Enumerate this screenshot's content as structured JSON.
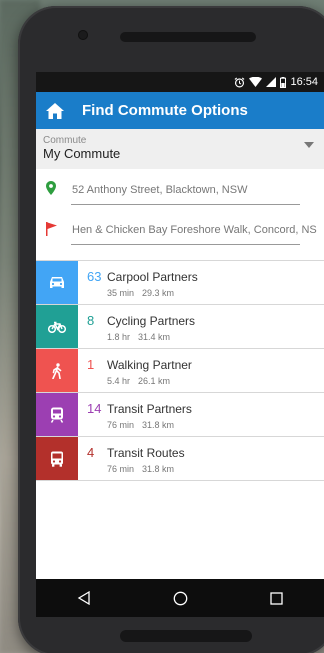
{
  "status_bar": {
    "time": "16:54",
    "icons": [
      "alarm-icon",
      "wifi-icon",
      "signal-icon",
      "battery-icon"
    ]
  },
  "app_bar": {
    "title": "Find Commute Options",
    "icon": "home-icon"
  },
  "commute": {
    "label": "Commute",
    "value": "My Commute"
  },
  "origin": {
    "text": "52 Anthony Street, Blacktown, NSW",
    "icon": "map-pin-icon",
    "color": "#2e9e3f"
  },
  "destination": {
    "text": "Hen & Chicken Bay Foreshore Walk, Concord, NS",
    "icon": "flag-icon",
    "color": "#e53935"
  },
  "options": [
    {
      "count": "63",
      "name": "Carpool Partners",
      "time": "35 min",
      "distance": "29.3 km",
      "icon": "car-icon",
      "tile_color": "#42a5f5",
      "count_color": "#42a5f5"
    },
    {
      "count": "8",
      "name": "Cycling Partners",
      "time": "1.8 hr",
      "distance": "31.4 km",
      "icon": "bicycle-icon",
      "tile_color": "#20a095",
      "count_color": "#20a095"
    },
    {
      "count": "1",
      "name": "Walking Partner",
      "time": "5.4 hr",
      "distance": "26.1 km",
      "icon": "walking-icon",
      "tile_color": "#ef5350",
      "count_color": "#ef5350"
    },
    {
      "count": "14",
      "name": "Transit Partners",
      "time": "76 min",
      "distance": "31.8 km",
      "icon": "train-icon",
      "tile_color": "#9c3fb2",
      "count_color": "#9c3fb2"
    },
    {
      "count": "4",
      "name": "Transit Routes",
      "time": "76 min",
      "distance": "31.8 km",
      "icon": "bus-icon",
      "tile_color": "#b3302b",
      "count_color": "#b3302b"
    }
  ],
  "nav_bar": {
    "buttons": [
      "back-icon",
      "home-circle-icon",
      "recents-icon"
    ]
  }
}
